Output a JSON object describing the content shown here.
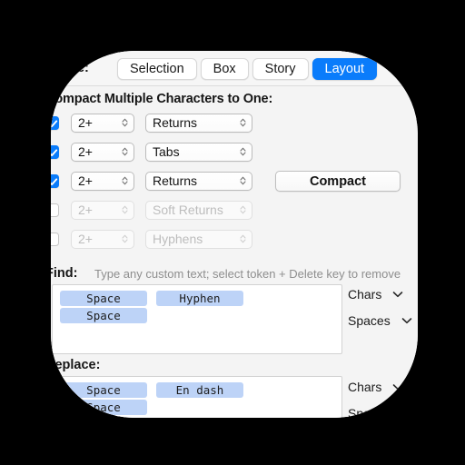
{
  "window": {
    "scope_label": "Scope:",
    "scope_label_clipped": "ope:",
    "section_title": "Compact Multiple Characters to One:"
  },
  "segmented_control": {
    "name": "scope-segmented-control",
    "options": [
      "Selection",
      "Box",
      "Story",
      "Layout"
    ],
    "selected": "Layout",
    "selected_color": "#0a7cfb"
  },
  "compact_rows": [
    {
      "checked": true,
      "count": "2+",
      "kind": "Returns",
      "enabled": true
    },
    {
      "checked": true,
      "count": "2+",
      "kind": "Tabs",
      "enabled": true
    },
    {
      "checked": true,
      "count": "2+",
      "kind": "Returns",
      "enabled": true
    },
    {
      "checked": false,
      "count": "2+",
      "kind": "Soft Returns",
      "enabled": false
    },
    {
      "checked": false,
      "count": "2+",
      "kind": "Hyphens",
      "enabled": false
    }
  ],
  "compact_button": {
    "label": "Compact"
  },
  "find": {
    "label": "Find:",
    "hint": "Type any custom text; select token + Delete key to remove",
    "tokens": [
      [
        "Space",
        "Hyphen"
      ],
      [
        "Space"
      ]
    ],
    "popups": [
      {
        "label": "Chars",
        "chevron": "chevron-down-icon"
      },
      {
        "label": "Spaces",
        "chevron": "chevron-down-icon"
      }
    ]
  },
  "replace": {
    "label": "Replace:",
    "tokens": [
      [
        "Space",
        "En dash"
      ],
      [
        "Space"
      ]
    ],
    "popups": [
      {
        "label": "Chars",
        "chevron": "chevron-down-icon"
      },
      {
        "label": "Spaces",
        "chevron": "chevron-down-icon"
      }
    ]
  },
  "colors": {
    "accent": "#0a7cfb",
    "token": "#bdd3f7",
    "panel": "#f4f4f4",
    "toolbar": "#f6f6f6",
    "backdrop": "#000000"
  }
}
